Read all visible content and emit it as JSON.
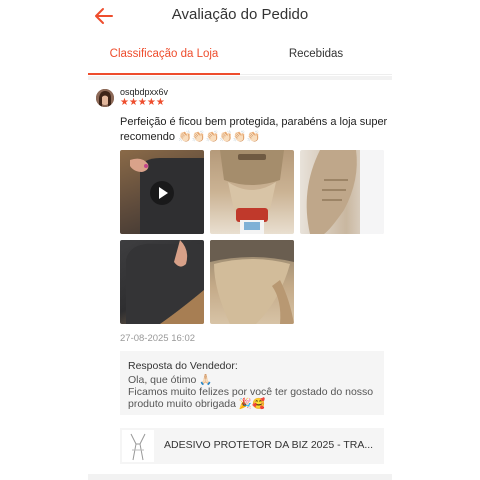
{
  "header": {
    "title": "Avaliação do Pedido",
    "back_icon": "arrow-left-icon",
    "accent_color": "#ee4d2d"
  },
  "tabs": [
    {
      "label": "Classificação da Loja",
      "active": true
    },
    {
      "label": "Recebidas",
      "active": false
    }
  ],
  "review": {
    "username": "osqbdpxx6v",
    "rating": 5,
    "stars_text": "★★★★★",
    "text": "Perfeição é ficou bem protegida, parabéns a loja super recomendo 👏🏻👏🏻👏🏻👏🏻👏🏻👏🏻",
    "media_count": 5,
    "first_media_is_video": true,
    "timestamp": "27-08-2025 16:02"
  },
  "seller_reply": {
    "title": "Resposta do Vendedor:",
    "text": "Ola, que ótimo 🙏🏻\nFicamos muito felizes por você ter gostado do nosso produto muito obrigada 🎉🥰"
  },
  "product": {
    "name": "ADESIVO PROTETOR DA BIZ 2025 - TRA..."
  }
}
